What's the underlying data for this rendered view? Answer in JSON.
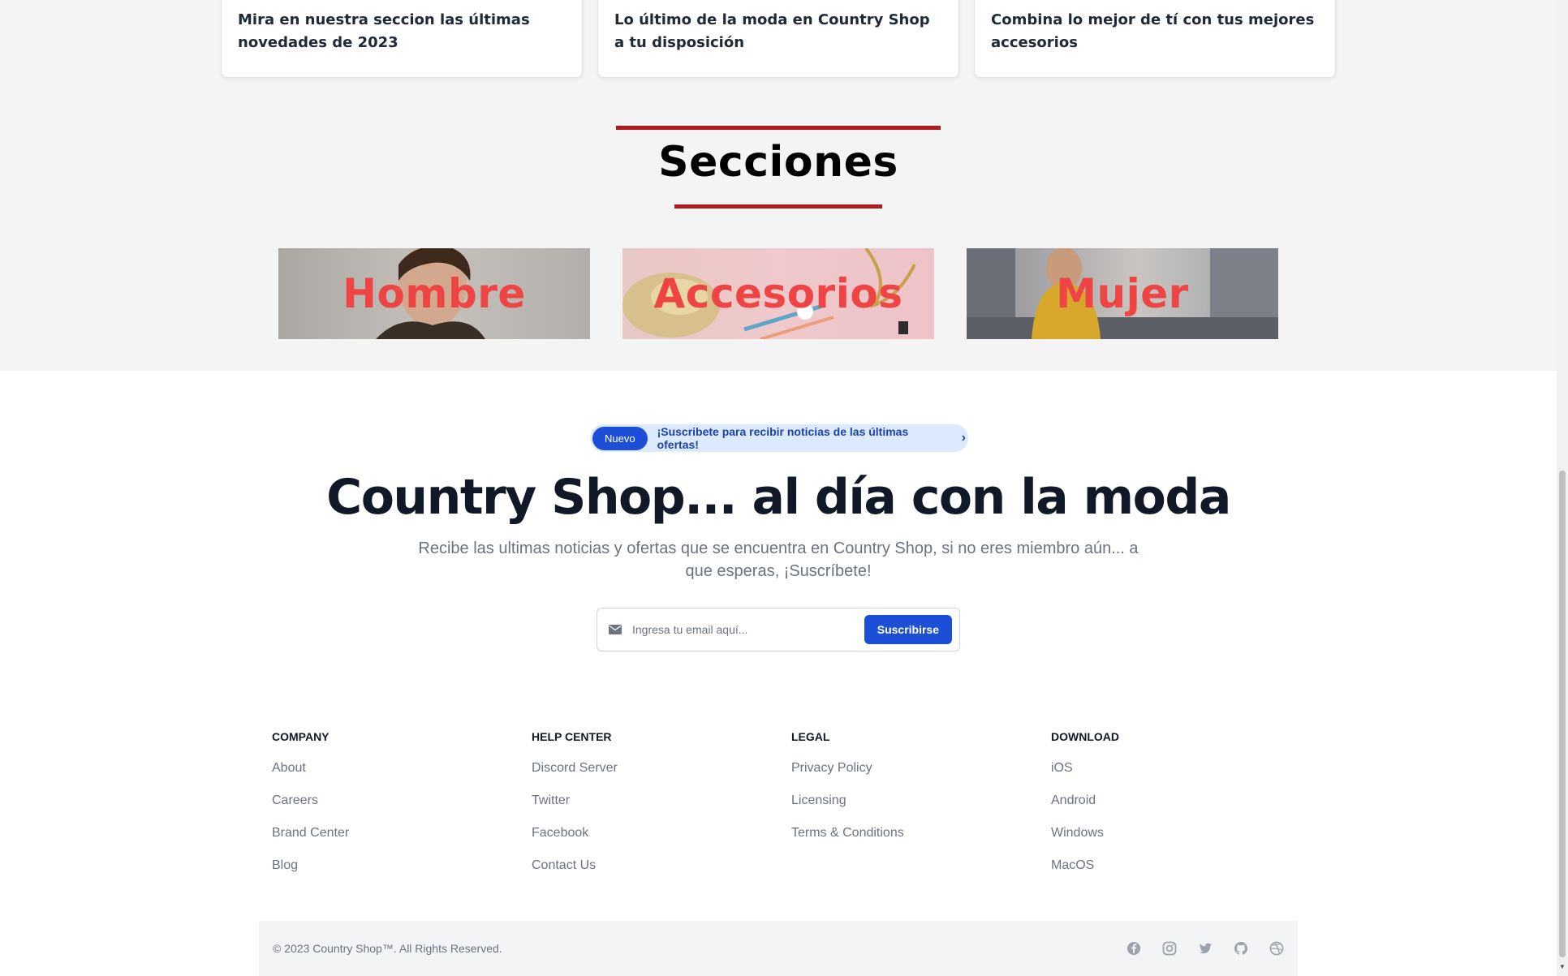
{
  "cards": [
    {
      "text": "Mira en nuestra seccion las últimas novedades de 2023"
    },
    {
      "text": "Lo último de la moda en Country Shop a tu disposición"
    },
    {
      "text": "Combina lo mejor de tí con tus mejores accesorios"
    }
  ],
  "sections": {
    "title": "Secciones",
    "tiles": [
      {
        "label": "Hombre"
      },
      {
        "label": "Accesorios"
      },
      {
        "label": "Mujer"
      }
    ]
  },
  "newsletter": {
    "badge": "Nuevo",
    "announcement": "¡Suscribete para recibir noticias de las últimas ofertas!",
    "title": "Country Shop... al día con la moda",
    "subtitle": "Recibe las ultimas noticias y ofertas que se encuentra en Country Shop, si no eres miembro aún... a que esperas, ¡Suscríbete!",
    "email_placeholder": "Ingresa tu email aquí...",
    "button": "Suscribirse"
  },
  "footer": {
    "columns": [
      {
        "heading": "Company",
        "links": [
          "About",
          "Careers",
          "Brand Center",
          "Blog"
        ]
      },
      {
        "heading": "Help center",
        "links": [
          "Discord Server",
          "Twitter",
          "Facebook",
          "Contact Us"
        ]
      },
      {
        "heading": "Legal",
        "links": [
          "Privacy Policy",
          "Licensing",
          "Terms & Conditions"
        ]
      },
      {
        "heading": "Download",
        "links": [
          "iOS",
          "Android",
          "Windows",
          "MacOS"
        ]
      }
    ],
    "copyright": "© 2023 Country Shop™. All Rights Reserved.",
    "social_icons": [
      "facebook-icon",
      "instagram-icon",
      "twitter-icon",
      "github-icon",
      "dribbble-icon"
    ]
  },
  "colors": {
    "accent_red": "#b0191e",
    "brand_blue": "#1d4ed8",
    "tile_label": "#ef4444"
  }
}
